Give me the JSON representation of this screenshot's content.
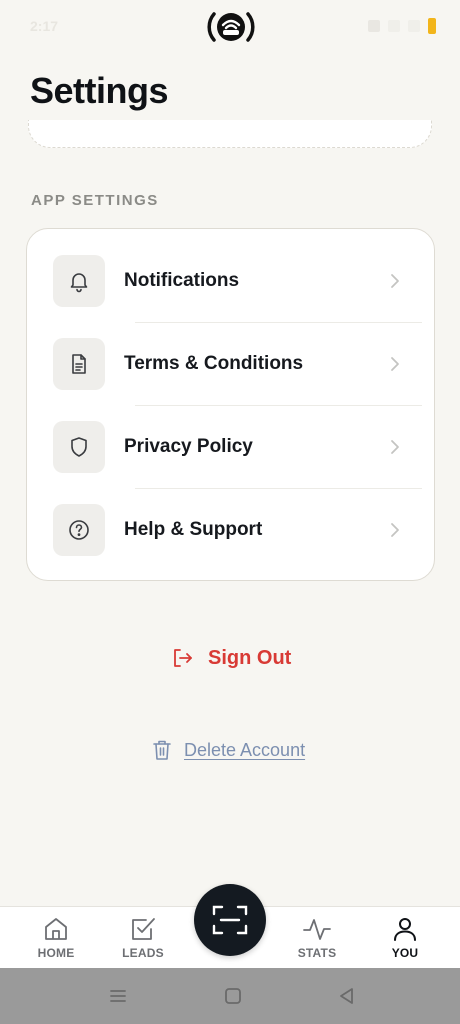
{
  "status_bar": {
    "time": "2:17"
  },
  "header": {
    "title": "Settings"
  },
  "app_settings": {
    "section_label": "APP SETTINGS",
    "items": [
      {
        "label": "Notifications",
        "icon": "bell-icon"
      },
      {
        "label": "Terms & Conditions",
        "icon": "document-icon"
      },
      {
        "label": "Privacy Policy",
        "icon": "shield-icon"
      },
      {
        "label": "Help & Support",
        "icon": "question-circle-icon"
      }
    ]
  },
  "actions": {
    "sign_out": "Sign Out",
    "delete_account": "Delete Account"
  },
  "tab_bar": {
    "tabs": [
      {
        "label": "HOME",
        "icon": "home-icon"
      },
      {
        "label": "LEADS",
        "icon": "checkbox-icon"
      },
      {
        "label": "STATS",
        "icon": "activity-icon"
      },
      {
        "label": "YOU",
        "icon": "user-icon",
        "active": true
      }
    ],
    "center_action_icon": "scan-icon"
  },
  "colors": {
    "background": "#f7f6f2",
    "danger": "#d83a35",
    "link_muted": "#7c8fb0",
    "dark": "#141a21"
  }
}
